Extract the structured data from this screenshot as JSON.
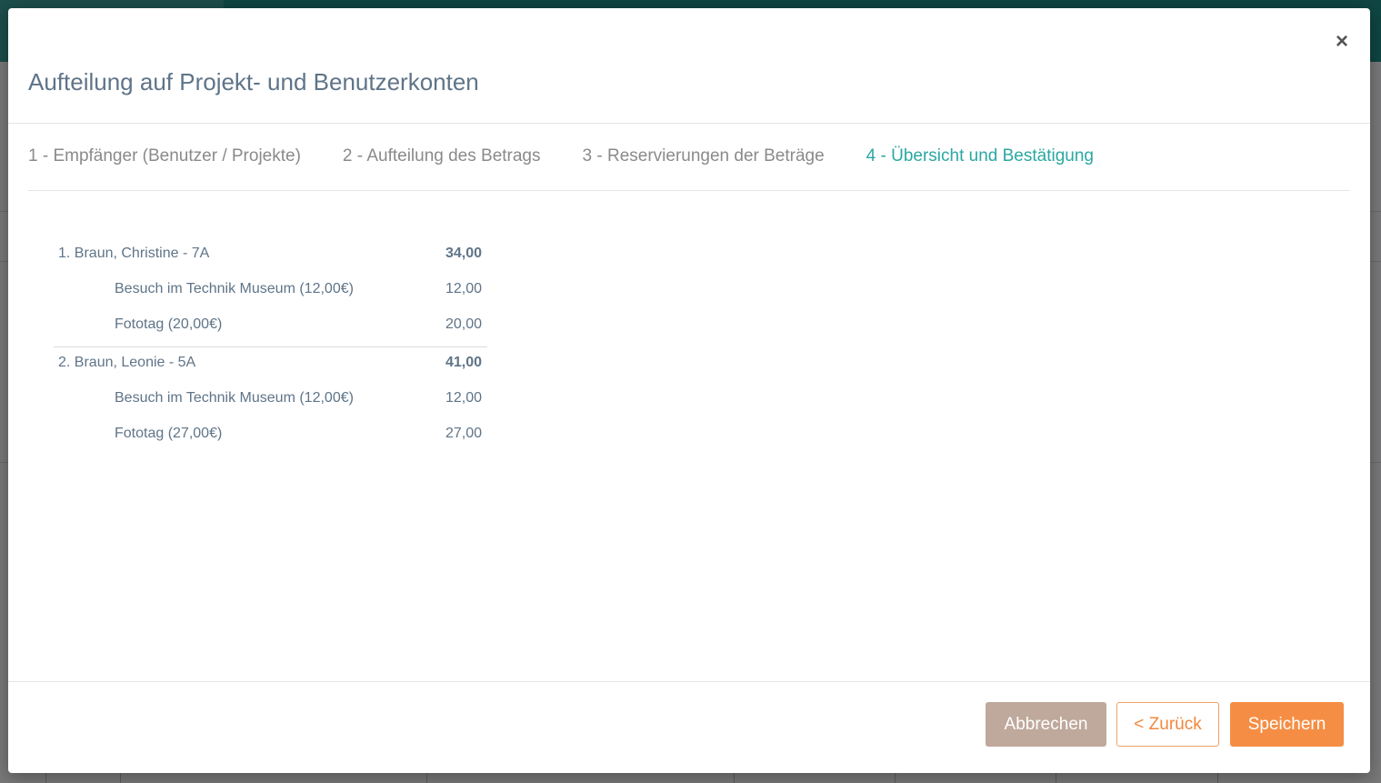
{
  "modal": {
    "title": "Aufteilung auf Projekt- und Benutzerkonten",
    "close_symbol": "×"
  },
  "steps": [
    {
      "label": "1 - Empfänger (Benutzer / Projekte)",
      "active": false
    },
    {
      "label": "2 - Aufteilung des Betrags",
      "active": false
    },
    {
      "label": "3 - Reservierungen der Beträge",
      "active": false
    },
    {
      "label": "4 - Übersicht und Bestätigung",
      "active": true
    }
  ],
  "summary": [
    {
      "name": "1. Braun, Christine - 7A",
      "total": "34,00",
      "items": [
        {
          "label": "Besuch im Technik Museum (12,00€)",
          "amount": "12,00"
        },
        {
          "label": "Fototag (20,00€)",
          "amount": "20,00"
        }
      ]
    },
    {
      "name": "2. Braun, Leonie - 5A",
      "total": "41,00",
      "items": [
        {
          "label": "Besuch im Technik Museum (12,00€)",
          "amount": "12,00"
        },
        {
          "label": "Fototag (27,00€)",
          "amount": "27,00"
        }
      ]
    }
  ],
  "footer": {
    "cancel_label": "Abbrechen",
    "back_label": "< Zurück",
    "save_label": "Speichern"
  },
  "colors": {
    "accent": "#2aa8a2",
    "primary": "#f58e44",
    "cancel": "#bfa99c"
  }
}
